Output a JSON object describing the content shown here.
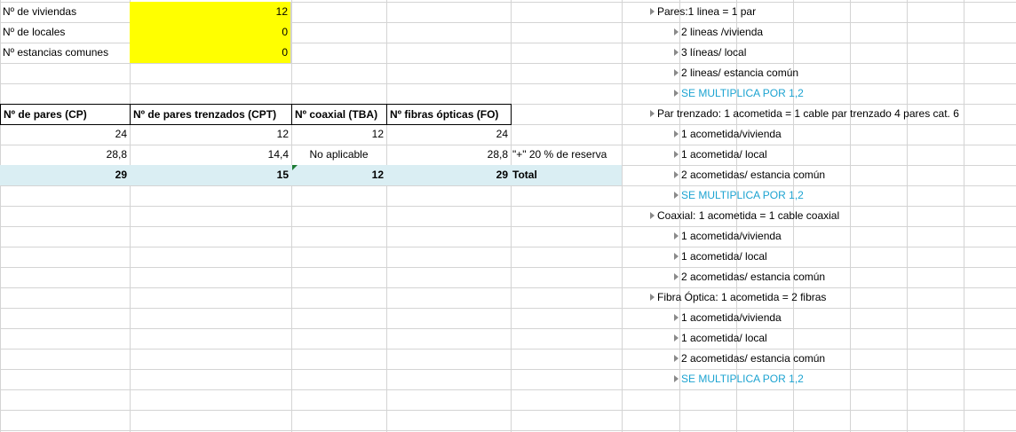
{
  "inputs": {
    "viviendas": {
      "label": "Nº de viviendas",
      "value": "12"
    },
    "locales": {
      "label": "Nº de locales",
      "value": "0"
    },
    "estancias": {
      "label": "Nº estancias comunes",
      "value": "0"
    }
  },
  "table": {
    "headers": [
      "Nº de pares (CP)",
      "Nº de pares trenzados (CPT)",
      "Nº coaxial (TBA)",
      "Nº fibras ópticas (FO)"
    ],
    "row1": [
      "24",
      "12",
      "12",
      "24"
    ],
    "row2": [
      "28,8",
      "14,4",
      "No aplicable",
      "28,8"
    ],
    "row2_note": "\"+\" 20 % de reserva",
    "total": [
      "29",
      "15",
      "12",
      "29"
    ],
    "total_label": "Total"
  },
  "notes": [
    {
      "text": "Pares:1 linea = 1 par",
      "level": 0,
      "style": "normal"
    },
    {
      "text": "2 lineas /vivienda",
      "level": 1,
      "style": "normal"
    },
    {
      "text": "3 líneas/ local",
      "level": 1,
      "style": "normal"
    },
    {
      "text": "2 lineas/ estancia común",
      "level": 1,
      "style": "normal"
    },
    {
      "text": "SE MULTIPLICA POR 1,2",
      "level": 1,
      "style": "cyan"
    },
    {
      "text": "Par trenzado: 1 acometida = 1 cable par trenzado 4 pares cat. 6",
      "level": 0,
      "style": "normal"
    },
    {
      "text": "1 acometida/vivienda",
      "level": 1,
      "style": "normal"
    },
    {
      "text": "1 acometida/ local",
      "level": 1,
      "style": "normal"
    },
    {
      "text": "2 acometidas/ estancia común",
      "level": 1,
      "style": "normal"
    },
    {
      "text": "SE MULTIPLICA POR 1,2",
      "level": 1,
      "style": "cyan"
    },
    {
      "text": "Coaxial: 1 acometida = 1 cable coaxial",
      "level": 0,
      "style": "normal"
    },
    {
      "text": "1 acometida/vivienda",
      "level": 1,
      "style": "normal"
    },
    {
      "text": "1 acometida/ local",
      "level": 1,
      "style": "normal"
    },
    {
      "text": "2 acometidas/ estancia común",
      "level": 1,
      "style": "normal"
    },
    {
      "text": "Fibra Óptica: 1 acometida = 2 fibras",
      "level": 0,
      "style": "normal"
    },
    {
      "text": "1 acometida/vivienda",
      "level": 1,
      "style": "normal"
    },
    {
      "text": "1 acometida/ local",
      "level": 1,
      "style": "normal"
    },
    {
      "text": "2 acometidas/ estancia común",
      "level": 1,
      "style": "normal"
    },
    {
      "text": "SE MULTIPLICA POR 1,2",
      "level": 1,
      "style": "cyan"
    }
  ],
  "colors": {
    "input_fill": "#ffff00",
    "total_fill": "#daeef3",
    "accent_text": "#1ca3d1"
  }
}
